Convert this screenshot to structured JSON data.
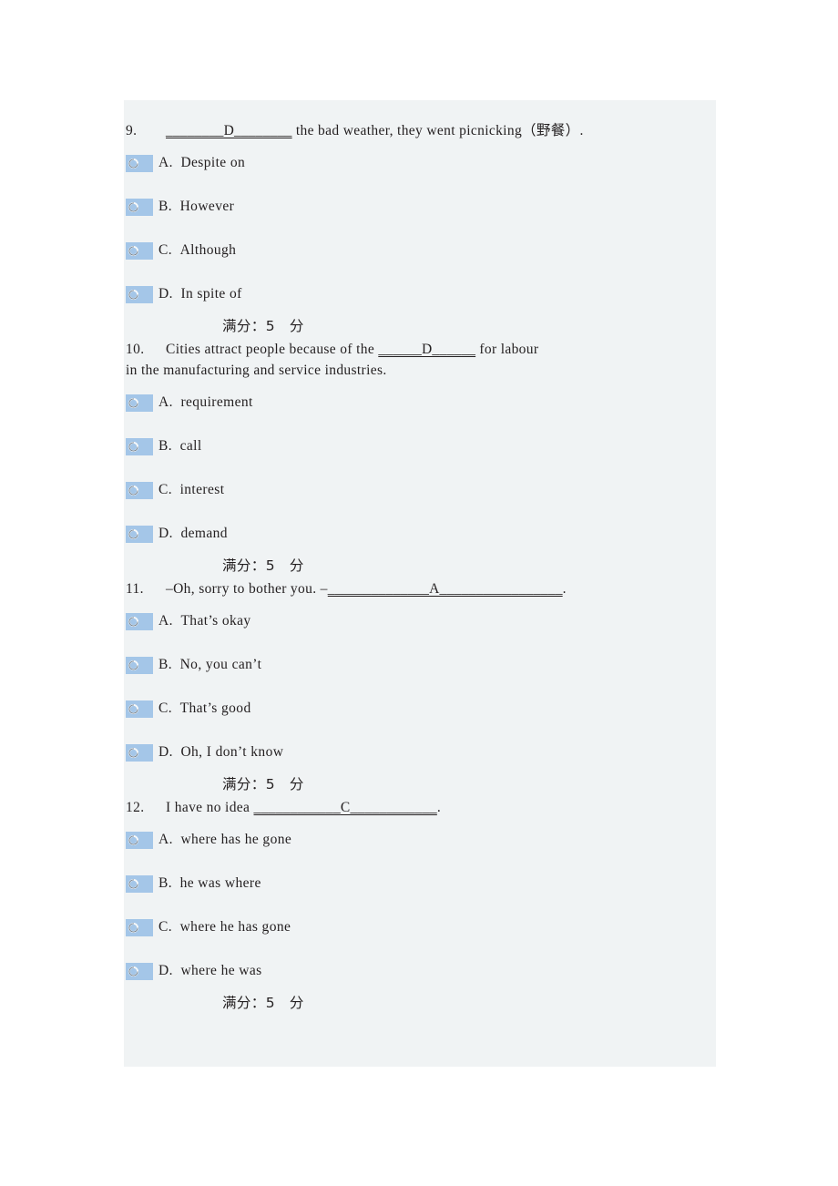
{
  "colors": {
    "panel_bg": "#f0f3f4",
    "page_bg": "#ffffff",
    "radio_blue": "#a4c6e8",
    "text": "#231f20"
  },
  "icons": {
    "radio": "radio-button-icon"
  },
  "quiz": {
    "score_line": "满分：5　分",
    "questions": [
      {
        "number": "9.",
        "stem_prefix": "",
        "stem_before_blank": "",
        "blank_prefix": "________",
        "blank_answer": "D",
        "blank_suffix": "________",
        "stem_after_blank": " the bad weather, they went picnicking（野餐）.",
        "stem_line2": "",
        "options": [
          {
            "letter": "A.",
            "text": "Despite on"
          },
          {
            "letter": "B.",
            "text": "However"
          },
          {
            "letter": "C.",
            "text": "Although"
          },
          {
            "letter": "D.",
            "text": "In spite of"
          }
        ]
      },
      {
        "number": "10.",
        "stem_prefix": "",
        "stem_before_blank": "Cities attract people because of the ",
        "blank_prefix": "______",
        "blank_answer": "D",
        "blank_suffix": "______",
        "stem_after_blank": " for labour",
        "stem_line2": "in the manufacturing and service industries.",
        "options": [
          {
            "letter": "A.",
            "text": "requirement"
          },
          {
            "letter": "B.",
            "text": "call"
          },
          {
            "letter": "C.",
            "text": "interest"
          },
          {
            "letter": "D.",
            "text": "demand"
          }
        ]
      },
      {
        "number": "11.",
        "stem_prefix": "",
        "stem_before_blank": "–Oh, sorry to bother you. –",
        "blank_prefix": "______________",
        "blank_answer": "A",
        "blank_suffix": "_________________",
        "stem_after_blank": ".",
        "stem_line2": "",
        "options": [
          {
            "letter": "A.",
            "text": "That’s okay"
          },
          {
            "letter": "B.",
            "text": "No, you can’t"
          },
          {
            "letter": "C.",
            "text": "That’s good"
          },
          {
            "letter": "D.",
            "text": "Oh, I don’t know"
          }
        ]
      },
      {
        "number": "12.",
        "stem_prefix": "",
        "stem_before_blank": "I have no idea ",
        "blank_prefix": "____________",
        "blank_answer": "C",
        "blank_suffix": "____________",
        "stem_after_blank": ".",
        "stem_line2": "",
        "options": [
          {
            "letter": "A.",
            "text": "where has he gone"
          },
          {
            "letter": "B.",
            "text": "he was where"
          },
          {
            "letter": "C.",
            "text": "where he has gone"
          },
          {
            "letter": "D.",
            "text": "where he was"
          }
        ]
      }
    ]
  }
}
